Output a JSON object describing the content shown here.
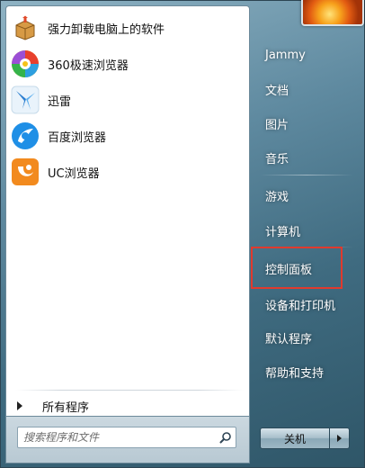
{
  "programs": [
    {
      "label": "强力卸载电脑上的软件",
      "icon": "uninstall-box-icon"
    },
    {
      "label": "360极速浏览器",
      "icon": "360-browser-icon"
    },
    {
      "label": "迅雷",
      "icon": "xunlei-bird-icon"
    },
    {
      "label": "百度浏览器",
      "icon": "baidu-browser-icon"
    },
    {
      "label": "UC浏览器",
      "icon": "uc-browser-icon"
    }
  ],
  "all_programs_label": "所有程序",
  "search": {
    "placeholder": "搜索程序和文件",
    "value": ""
  },
  "right_items": [
    {
      "label": "Jammy"
    },
    {
      "label": "文档"
    },
    {
      "label": "图片"
    },
    {
      "label": "音乐"
    },
    {
      "label": "游戏"
    },
    {
      "label": "计算机"
    },
    {
      "label": "控制面板"
    },
    {
      "label": "设备和打印机"
    },
    {
      "label": "默认程序"
    },
    {
      "label": "帮助和支持"
    }
  ],
  "shutdown_label": "关机",
  "colors": {
    "highlight": "#e03a2e"
  }
}
